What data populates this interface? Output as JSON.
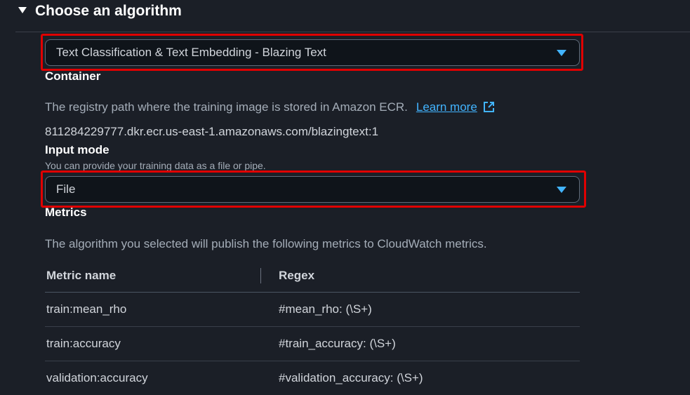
{
  "section": {
    "title": "Choose an algorithm"
  },
  "algorithm": {
    "selected": "Text Classification & Text Embedding - Blazing Text"
  },
  "container": {
    "label": "Container",
    "description": "The registry path where the training image is stored in Amazon ECR.",
    "learn_more": "Learn more",
    "path": "811284229777.dkr.ecr.us-east-1.amazonaws.com/blazingtext:1"
  },
  "input_mode": {
    "label": "Input mode",
    "description": "You can provide your training data as a file or pipe.",
    "selected": "File"
  },
  "metrics": {
    "label": "Metrics",
    "description": "The algorithm you selected will publish the following metrics to CloudWatch metrics.",
    "columns": [
      "Metric name",
      "Regex"
    ],
    "rows": [
      [
        "train:mean_rho",
        "#mean_rho: (\\S+)"
      ],
      [
        "train:accuracy",
        "#train_accuracy: (\\S+)"
      ],
      [
        "validation:accuracy",
        "#validation_accuracy: (\\S+)"
      ]
    ]
  },
  "colors": {
    "background": "#1b1f27",
    "link": "#42b4ff",
    "highlight": "#e00000"
  }
}
